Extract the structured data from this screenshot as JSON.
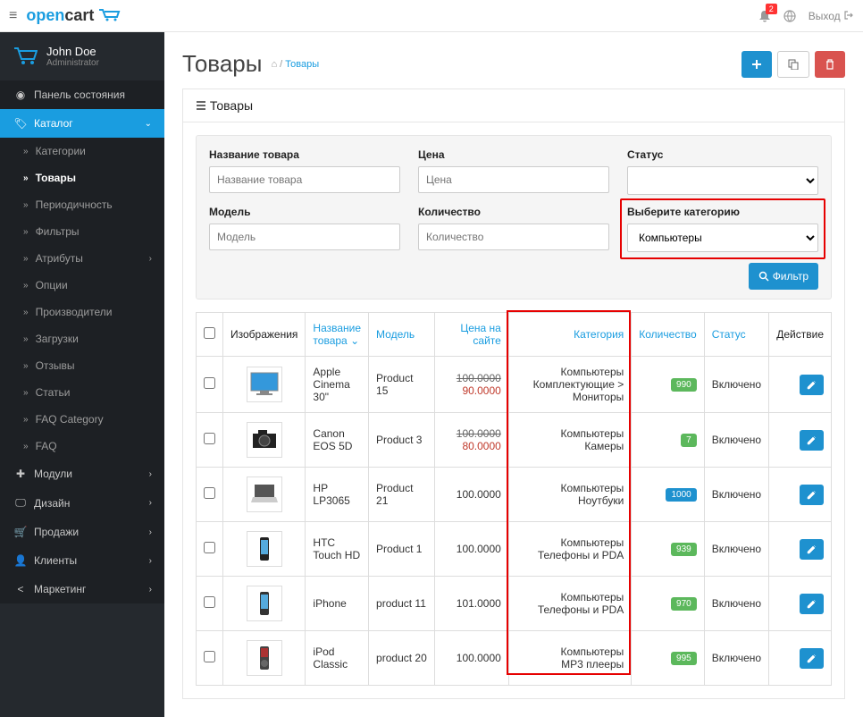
{
  "brand": {
    "open": "open",
    "cart": "cart"
  },
  "topbar": {
    "badge": "2",
    "logout": "Выход"
  },
  "user": {
    "name": "John Doe",
    "role": "Administrator"
  },
  "sidebar": {
    "dashboard": "Панель состояния",
    "catalog": "Каталог",
    "sub": {
      "categories": "Категории",
      "products": "Товары",
      "recurring": "Периодичность",
      "filters": "Фильтры",
      "attributes": "Атрибуты",
      "options": "Опции",
      "manufacturers": "Производители",
      "downloads": "Загрузки",
      "reviews": "Отзывы",
      "articles": "Статьи",
      "faqcat": "FAQ Category",
      "faq": "FAQ"
    },
    "modules": "Модули",
    "design": "Дизайн",
    "sales": "Продажи",
    "clients": "Клиенты",
    "marketing": "Маркетинг"
  },
  "page": {
    "title": "Товары",
    "bc_current": "Товары",
    "panel_title": "Товары"
  },
  "filters": {
    "name_label": "Название товара",
    "name_ph": "Название товара",
    "price_label": "Цена",
    "price_ph": "Цена",
    "status_label": "Статус",
    "model_label": "Модель",
    "model_ph": "Модель",
    "qty_label": "Количество",
    "qty_ph": "Количество",
    "category_label": "Выберите категорию",
    "category_value": "Компьютеры",
    "button": "Фильтр"
  },
  "table": {
    "headers": {
      "image": "Изображения",
      "name": "Название товара",
      "model": "Модель",
      "price": "Цена на сайте",
      "category": "Категория",
      "qty": "Количество",
      "status": "Статус",
      "action": "Действие"
    },
    "rows": [
      {
        "name": "Apple Cinema 30\"",
        "model": "Product 15",
        "price_old": "100.0000",
        "price_new": "90.0000",
        "cat1": "Компьютеры",
        "cat2": "Комплектующие  >  Мониторы",
        "qty": "990",
        "qty_class": "",
        "status": "Включено",
        "thumbColor": "#3498db",
        "thumbShape": "monitor"
      },
      {
        "name": "Canon EOS 5D",
        "model": "Product 3",
        "price_old": "100.0000",
        "price_new": "80.0000",
        "cat1": "Компьютеры",
        "cat2": "Камеры",
        "qty": "7",
        "qty_class": "",
        "status": "Включено",
        "thumbColor": "#222",
        "thumbShape": "camera"
      },
      {
        "name": "HP LP3065",
        "model": "Product 21",
        "price_old": "",
        "price_new": "100.0000",
        "cat1": "Компьютеры",
        "cat2": "Ноутбуки",
        "qty": "1000",
        "qty_class": "info",
        "status": "Включено",
        "thumbColor": "#555",
        "thumbShape": "laptop"
      },
      {
        "name": "HTC Touch HD",
        "model": "Product 1",
        "price_old": "",
        "price_new": "100.0000",
        "cat1": "Компьютеры",
        "cat2": "Телефоны и PDA",
        "qty": "939",
        "qty_class": "",
        "status": "Включено",
        "thumbColor": "#222",
        "thumbShape": "phone"
      },
      {
        "name": "iPhone",
        "model": "product 11",
        "price_old": "",
        "price_new": "101.0000",
        "cat1": "Компьютеры",
        "cat2": "Телефоны и PDA",
        "qty": "970",
        "qty_class": "",
        "status": "Включено",
        "thumbColor": "#333",
        "thumbShape": "phone"
      },
      {
        "name": "iPod Classic",
        "model": "product 20",
        "price_old": "",
        "price_new": "100.0000",
        "cat1": "Компьютеры",
        "cat2": "MP3 плееры",
        "qty": "995",
        "qty_class": "",
        "status": "Включено",
        "thumbColor": "#444",
        "thumbShape": "ipod"
      }
    ]
  }
}
